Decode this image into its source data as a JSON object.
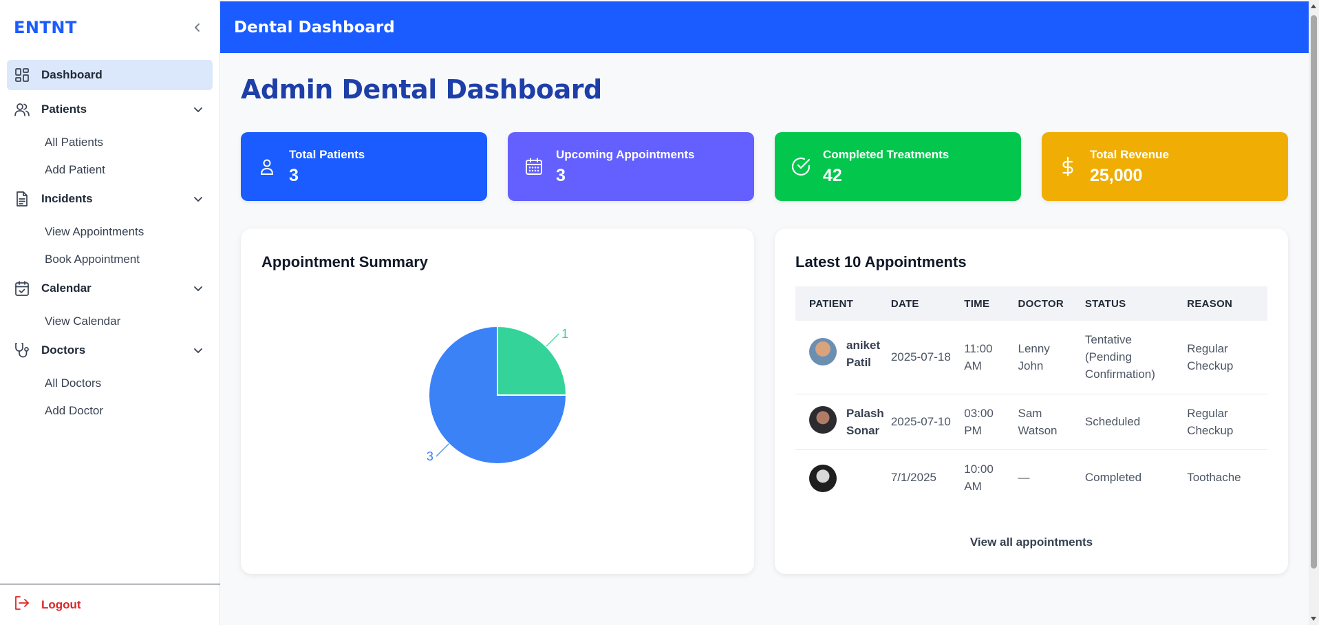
{
  "sidebar": {
    "brand": "ENTNT",
    "items": [
      {
        "label": "Dashboard",
        "icon": "grid-icon"
      },
      {
        "label": "Patients",
        "icon": "users-icon",
        "children": [
          "All Patients",
          "Add Patient"
        ]
      },
      {
        "label": "Incidents",
        "icon": "document-icon",
        "children": [
          "View Appointments",
          "Book Appointment"
        ]
      },
      {
        "label": "Calendar",
        "icon": "calendar-check-icon",
        "children": [
          "View Calendar"
        ]
      },
      {
        "label": "Doctors",
        "icon": "stethoscope-icon",
        "children": [
          "All Doctors",
          "Add Doctor"
        ]
      }
    ],
    "logout": "Logout"
  },
  "header": {
    "title": "Dental Dashboard"
  },
  "main": {
    "title": "Admin Dental Dashboard",
    "stats": [
      {
        "label": "Total Patients",
        "value": "3",
        "icon": "user-icon",
        "color": "#1a5cff"
      },
      {
        "label": "Upcoming Appointments",
        "value": "3",
        "icon": "calendar-icon",
        "color": "#6360ff"
      },
      {
        "label": "Completed Treatments",
        "value": "42",
        "icon": "check-circle-icon",
        "color": "#03c74d"
      },
      {
        "label": "Total Revenue",
        "value": "25,000",
        "icon": "dollar-icon",
        "color": "#f0ae05"
      }
    ],
    "summary": {
      "title": "Appointment Summary"
    },
    "appointments": {
      "title": "Latest 10 Appointments",
      "columns": [
        "PATIENT",
        "DATE",
        "TIME",
        "DOCTOR",
        "STATUS",
        "REASON"
      ],
      "rows": [
        {
          "patient": "aniket Patil",
          "date": "2025-07-18",
          "time": "11:00 AM",
          "doctor": "Lenny John",
          "status": "Tentative (Pending Confirmation)",
          "reason": "Regular Checkup"
        },
        {
          "patient": "Palash Sonar",
          "date": "2025-07-10",
          "time": "03:00 PM",
          "doctor": "Sam Watson",
          "status": "Scheduled",
          "reason": "Regular Checkup"
        },
        {
          "patient": "",
          "date": "7/1/2025",
          "time": "10:00 AM",
          "doctor": "—",
          "status": "Completed",
          "reason": "Toothache"
        }
      ],
      "view_all": "View all appointments"
    }
  },
  "chart_data": {
    "type": "pie",
    "values": [
      1,
      3
    ],
    "data_labels": [
      "1",
      "3"
    ],
    "colors": [
      "#34d399",
      "#3b82f6"
    ]
  }
}
